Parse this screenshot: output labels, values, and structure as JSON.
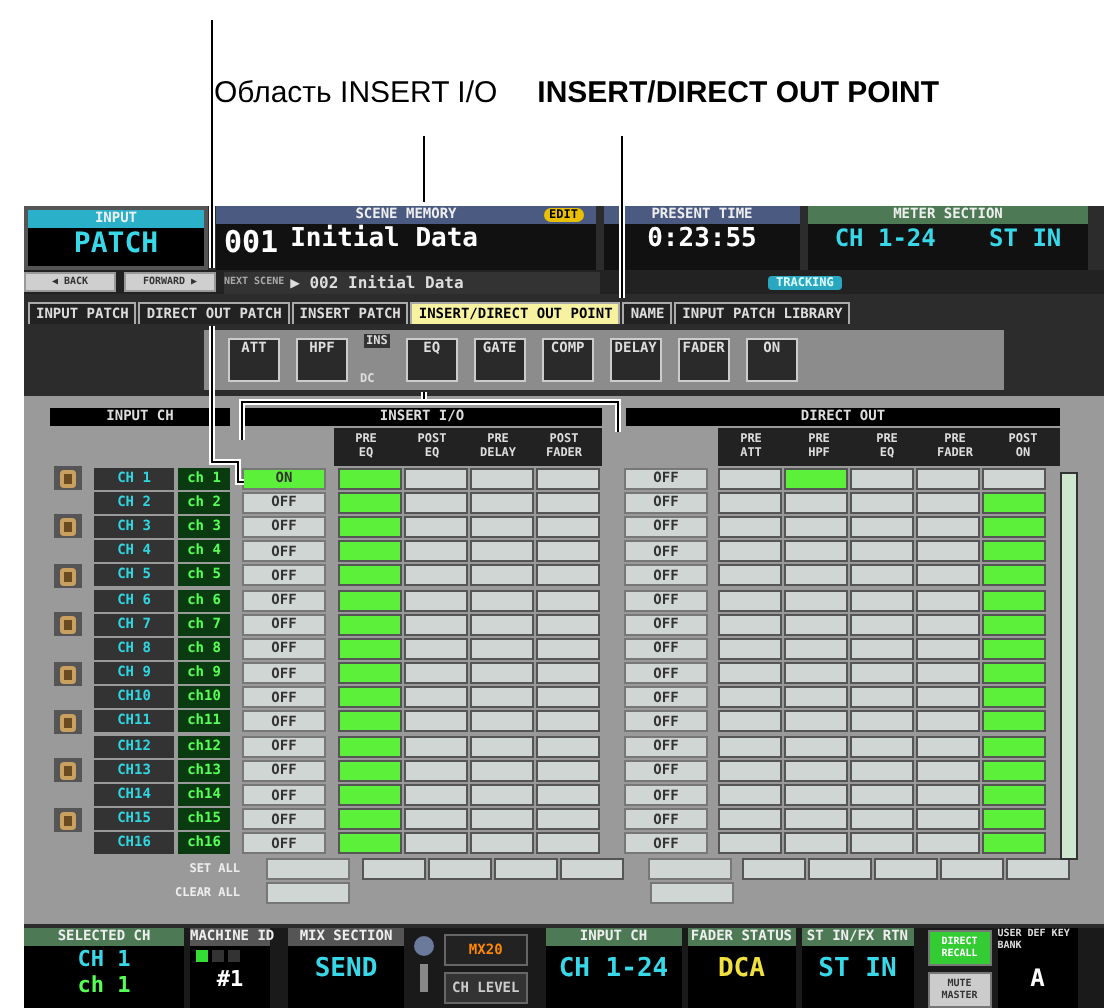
{
  "callouts": {
    "area_label": "Область INSERT I/O",
    "tab_label": "INSERT/DIRECT OUT POINT"
  },
  "header": {
    "patch": {
      "caption": "INPUT",
      "title": "PATCH"
    },
    "nav": [
      "◀ BACK",
      "FORWARD ▶"
    ],
    "scene_memory": {
      "caption": "SCENE MEMORY",
      "badge": "EDIT",
      "number": "001",
      "name": "Initial Data",
      "next_label": "NEXT SCENE",
      "next": "▶ 002 Initial Data"
    },
    "present_time": {
      "caption": "PRESENT TIME",
      "value": "0:23:55",
      "badge": "TRACKING"
    },
    "meter_section": {
      "caption": "METER SECTION",
      "buttons": [
        "CH 1-24",
        "ST IN"
      ]
    }
  },
  "tabs": [
    {
      "label": "INPUT PATCH",
      "selected": false
    },
    {
      "label": "DIRECT OUT PATCH",
      "selected": false
    },
    {
      "label": "INSERT PATCH",
      "selected": false
    },
    {
      "label": "INSERT/DIRECT OUT POINT",
      "selected": true
    },
    {
      "label": "NAME",
      "selected": false
    },
    {
      "label": "INPUT PATCH LIBRARY",
      "selected": false
    }
  ],
  "flow": [
    {
      "kind": "block",
      "label": "ATT"
    },
    {
      "kind": "block",
      "label": "HPF"
    },
    {
      "kind": "tag",
      "label": "INS"
    },
    {
      "kind": "block",
      "label": "EQ"
    },
    {
      "kind": "block",
      "label": "GATE"
    },
    {
      "kind": "block",
      "label": "COMP"
    },
    {
      "kind": "block",
      "label": "DELAY"
    },
    {
      "kind": "block",
      "label": "FADER"
    },
    {
      "kind": "block",
      "label": "ON"
    }
  ],
  "flow_note": "DC",
  "table": {
    "input_header": "INPUT CH",
    "insert_header": "INSERT I/O",
    "insert_columns": [
      "PRE EQ",
      "POST EQ",
      "PRE DELAY",
      "POST FADER"
    ],
    "direct_header": "DIRECT OUT",
    "direct_columns": [
      "PRE ATT",
      "PRE HPF",
      "PRE EQ",
      "PRE FADER",
      "POST ON"
    ],
    "rows": [
      {
        "ch": "CH 1",
        "name": "ch 1",
        "insert": "ON",
        "insert_on": true,
        "insert_point": [
          true,
          false,
          false,
          false
        ],
        "direct": "OFF",
        "direct_on": false,
        "direct_point": [
          false,
          true,
          false,
          false,
          false
        ]
      },
      {
        "ch": "CH 2",
        "name": "ch 2",
        "insert": "OFF",
        "insert_on": false,
        "insert_point": [
          true,
          false,
          false,
          false
        ],
        "direct": "OFF",
        "direct_on": false,
        "direct_point": [
          false,
          false,
          false,
          false,
          true
        ]
      },
      {
        "ch": "CH 3",
        "name": "ch 3",
        "insert": "OFF",
        "insert_on": false,
        "insert_point": [
          true,
          false,
          false,
          false
        ],
        "direct": "OFF",
        "direct_on": false,
        "direct_point": [
          false,
          false,
          false,
          false,
          true
        ]
      },
      {
        "ch": "CH 4",
        "name": "ch 4",
        "insert": "OFF",
        "insert_on": false,
        "insert_point": [
          true,
          false,
          false,
          false
        ],
        "direct": "OFF",
        "direct_on": false,
        "direct_point": [
          false,
          false,
          false,
          false,
          true
        ]
      },
      {
        "ch": "CH 5",
        "name": "ch 5",
        "insert": "OFF",
        "insert_on": false,
        "insert_point": [
          true,
          false,
          false,
          false
        ],
        "direct": "OFF",
        "direct_on": false,
        "direct_point": [
          false,
          false,
          false,
          false,
          true
        ]
      },
      {
        "ch": "CH 6",
        "name": "ch 6",
        "insert": "OFF",
        "insert_on": false,
        "insert_point": [
          true,
          false,
          false,
          false
        ],
        "direct": "OFF",
        "direct_on": false,
        "direct_point": [
          false,
          false,
          false,
          false,
          true
        ]
      },
      {
        "ch": "CH 7",
        "name": "ch 7",
        "insert": "OFF",
        "insert_on": false,
        "insert_point": [
          true,
          false,
          false,
          false
        ],
        "direct": "OFF",
        "direct_on": false,
        "direct_point": [
          false,
          false,
          false,
          false,
          true
        ]
      },
      {
        "ch": "CH 8",
        "name": "ch 8",
        "insert": "OFF",
        "insert_on": false,
        "insert_point": [
          true,
          false,
          false,
          false
        ],
        "direct": "OFF",
        "direct_on": false,
        "direct_point": [
          false,
          false,
          false,
          false,
          true
        ]
      },
      {
        "ch": "CH 9",
        "name": "ch 9",
        "insert": "OFF",
        "insert_on": false,
        "insert_point": [
          true,
          false,
          false,
          false
        ],
        "direct": "OFF",
        "direct_on": false,
        "direct_point": [
          false,
          false,
          false,
          false,
          true
        ]
      },
      {
        "ch": "CH10",
        "name": "ch10",
        "insert": "OFF",
        "insert_on": false,
        "insert_point": [
          true,
          false,
          false,
          false
        ],
        "direct": "OFF",
        "direct_on": false,
        "direct_point": [
          false,
          false,
          false,
          false,
          true
        ]
      },
      {
        "ch": "CH11",
        "name": "ch11",
        "insert": "OFF",
        "insert_on": false,
        "insert_point": [
          true,
          false,
          false,
          false
        ],
        "direct": "OFF",
        "direct_on": false,
        "direct_point": [
          false,
          false,
          false,
          false,
          true
        ]
      },
      {
        "ch": "CH12",
        "name": "ch12",
        "insert": "OFF",
        "insert_on": false,
        "insert_point": [
          true,
          false,
          false,
          false
        ],
        "direct": "OFF",
        "direct_on": false,
        "direct_point": [
          false,
          false,
          false,
          false,
          true
        ]
      },
      {
        "ch": "CH13",
        "name": "ch13",
        "insert": "OFF",
        "insert_on": false,
        "insert_point": [
          true,
          false,
          false,
          false
        ],
        "direct": "OFF",
        "direct_on": false,
        "direct_point": [
          false,
          false,
          false,
          false,
          true
        ]
      },
      {
        "ch": "CH14",
        "name": "ch14",
        "insert": "OFF",
        "insert_on": false,
        "insert_point": [
          true,
          false,
          false,
          false
        ],
        "direct": "OFF",
        "direct_on": false,
        "direct_point": [
          false,
          false,
          false,
          false,
          true
        ]
      },
      {
        "ch": "CH15",
        "name": "ch15",
        "insert": "OFF",
        "insert_on": false,
        "insert_point": [
          true,
          false,
          false,
          false
        ],
        "direct": "OFF",
        "direct_on": false,
        "direct_point": [
          false,
          false,
          false,
          false,
          true
        ]
      },
      {
        "ch": "CH16",
        "name": "ch16",
        "insert": "OFF",
        "insert_on": false,
        "insert_point": [
          true,
          false,
          false,
          false
        ],
        "direct": "OFF",
        "direct_on": false,
        "direct_point": [
          false,
          false,
          false,
          false,
          true
        ]
      }
    ],
    "set_all": "SET ALL",
    "clear_all": "CLEAR ALL"
  },
  "bottom": {
    "selected_ch": {
      "caption": "SELECTED CH",
      "ch": "CH 1",
      "name": "ch 1"
    },
    "machine_id": {
      "caption": "MACHINE ID",
      "value": "#1",
      "slots": [
        {
          "selected": true
        },
        {
          "selected": false
        },
        {
          "selected": false
        }
      ]
    },
    "mix_section": {
      "caption": "MIX SECTION",
      "value": "SEND"
    },
    "mix_buttons": [
      "MX20",
      "CH LEVEL"
    ],
    "input_ch": {
      "caption": "INPUT CH",
      "value": "CH 1-24"
    },
    "fader_status": {
      "caption": "FADER STATUS",
      "value": "DCA"
    },
    "st_in": {
      "caption": "ST IN/FX RTN",
      "value": "ST IN"
    },
    "direct_recall": "DIRECT RECALL",
    "mute_master": "MUTE MASTER",
    "user_def": {
      "caption": "USER DEF KEY BANK",
      "value": "A"
    }
  }
}
